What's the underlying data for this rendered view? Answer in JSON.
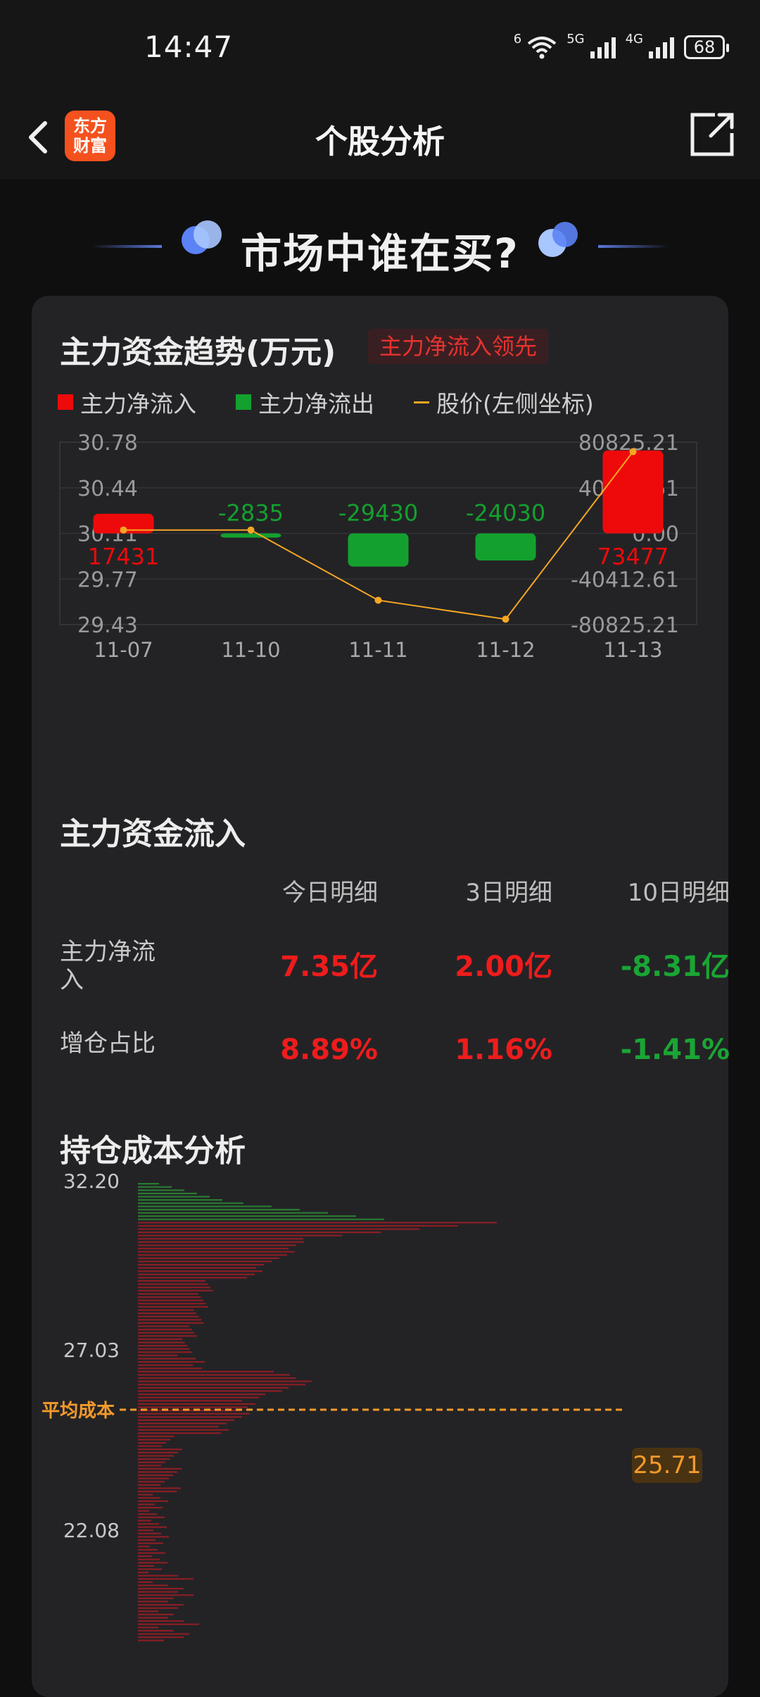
{
  "status_bar": {
    "time": "14:47",
    "wifi_label": "6",
    "sim1_label": "5G",
    "sim2_label": "4G",
    "battery": "68"
  },
  "nav": {
    "back_icon": "chevron-left-icon",
    "logo_line1": "东方",
    "logo_line2": "财富",
    "title": "个股分析",
    "share_icon": "external-share-icon"
  },
  "banner": {
    "title": "市场中谁在买?"
  },
  "trend_section": {
    "title": "主力资金趋势(万元)",
    "tag": "主力净流入领先",
    "legend": [
      "主力净流入",
      "主力净流出",
      "股价(左侧坐标)"
    ]
  },
  "colors": {
    "inflow": "#ee0a0a",
    "outflow": "#14a02e",
    "price_line": "#f5a623",
    "avg_cost": "#f39a2b"
  },
  "chart_data": [
    {
      "type": "bar",
      "title": "主力资金趋势(万元)",
      "categories": [
        "11-07",
        "11-10",
        "11-11",
        "11-12",
        "11-13"
      ],
      "series": [
        {
          "name": "主力净流入",
          "values": [
            17431,
            -2835,
            -29430,
            -24030,
            73477
          ]
        },
        {
          "name": "股价(左侧坐标)",
          "type": "line",
          "values": [
            30.13,
            30.13,
            29.61,
            29.47,
            30.71
          ]
        }
      ],
      "left_axis": {
        "ticks": [
          "30.78",
          "30.44",
          "30.11",
          "29.77",
          "29.43"
        ],
        "range": [
          29.43,
          30.78
        ]
      },
      "right_axis": {
        "ticks": [
          "80825.21",
          "40412.61",
          "0.00",
          "-40412.61",
          "-80825.21"
        ],
        "range": [
          -80825.21,
          80825.21
        ]
      },
      "legend_position": "top-left",
      "grid": true
    },
    {
      "type": "bar",
      "title": "持仓成本分析",
      "orientation": "horizontal",
      "y_ticks": [
        "32.20",
        "27.03",
        "22.08"
      ],
      "average_cost": {
        "label": "平均成本",
        "value": "25.71"
      }
    }
  ],
  "flow_section": {
    "title": "主力资金流入",
    "headers": [
      "今日明细",
      "3日明细",
      "10日明细"
    ],
    "rows": [
      {
        "label": "主力净流入",
        "values": [
          "7.35亿",
          "2.00亿",
          "-8.31亿"
        ]
      },
      {
        "label": "增仓占比",
        "values": [
          "8.89%",
          "1.16%",
          "-1.41%"
        ]
      }
    ]
  },
  "cost_section": {
    "title": "持仓成本分析"
  }
}
